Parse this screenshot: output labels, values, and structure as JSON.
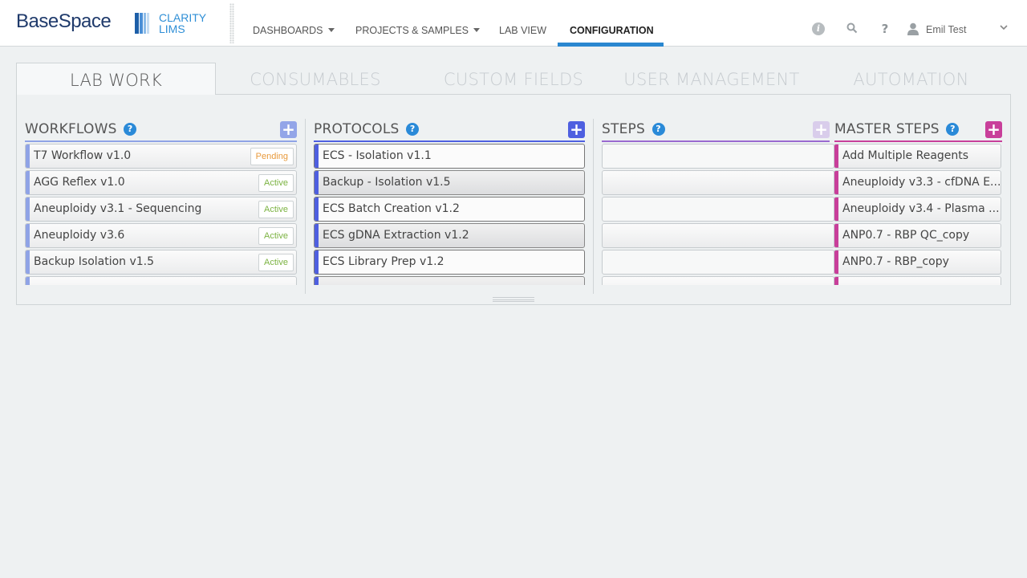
{
  "brand": {
    "basespace": "BaseSpace",
    "clarity_line1": "CLARITY",
    "clarity_line2": "LIMS"
  },
  "nav": {
    "dashboards": "DASHBOARDS",
    "projects_samples": "PROJECTS & SAMPLES",
    "lab_view": "LAB VIEW",
    "configuration": "CONFIGURATION"
  },
  "header_icons": {
    "info": "info-icon",
    "search": "search-icon",
    "help": "help-icon",
    "user": "user-icon",
    "chevron": "chevron-down-icon"
  },
  "user": {
    "name": "Emil Test"
  },
  "tabs": [
    "LAB WORK",
    "CONSUMABLES",
    "CUSTOM FIELDS",
    "USER MANAGEMENT",
    "AUTOMATION"
  ],
  "active_tab": "LAB WORK",
  "columns": {
    "workflows": {
      "title": "WORKFLOWS",
      "help": "?",
      "add": "+",
      "color": "#8fa3e6",
      "items": [
        {
          "name": "T7 Workflow v1.0",
          "status": "Pending"
        },
        {
          "name": "AGG Reflex v1.0",
          "status": "Active"
        },
        {
          "name": "Aneuploidy v3.1 - Sequencing",
          "status": "Active"
        },
        {
          "name": "Aneuploidy v3.6",
          "status": "Active"
        },
        {
          "name": "Backup Isolation v1.5",
          "status": "Active"
        }
      ]
    },
    "protocols": {
      "title": "PROTOCOLS",
      "help": "?",
      "add": "+",
      "color": "#4e5fe0",
      "items": [
        {
          "name": "ECS - Isolation v1.1"
        },
        {
          "name": "Backup - Isolation v1.5"
        },
        {
          "name": "ECS Batch Creation v1.2"
        },
        {
          "name": "ECS gDNA Extraction v1.2"
        },
        {
          "name": "ECS Library Prep v1.2"
        }
      ]
    },
    "steps": {
      "title": "STEPS",
      "help": "?",
      "add": "+",
      "color": "#9a6ad0"
    },
    "master_steps": {
      "title": "MASTER STEPS",
      "help": "?",
      "add": "+",
      "color": "#c83f9a",
      "items": [
        {
          "name": "Add Multiple Reagents"
        },
        {
          "name": "Aneuploidy v3.3 - cfDNA E..."
        },
        {
          "name": "Aneuploidy v3.4 - Plasma ..."
        },
        {
          "name": "ANP0.7 - RBP QC_copy"
        },
        {
          "name": "ANP0.7 - RBP_copy"
        }
      ]
    }
  }
}
